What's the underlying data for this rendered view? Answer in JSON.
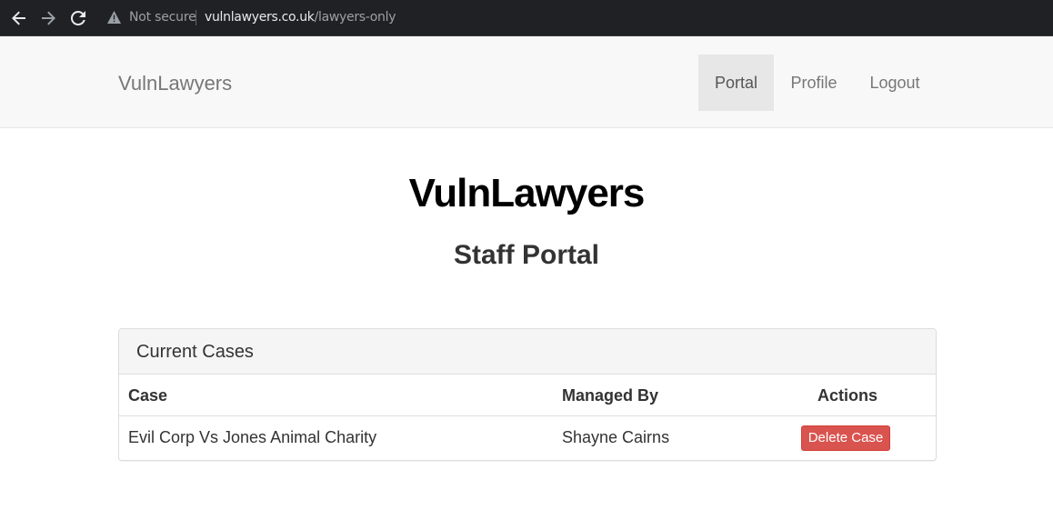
{
  "browser": {
    "security_label": "Not secure",
    "url_host": "vulnlawyers.co.uk",
    "url_path": "/lawyers-only",
    "icons": {
      "back": "arrow-left-icon",
      "forward": "arrow-right-icon",
      "reload": "reload-icon",
      "warning": "warning-triangle-icon"
    }
  },
  "navbar": {
    "brand": "VulnLawyers",
    "items": [
      {
        "label": "Portal",
        "active": true
      },
      {
        "label": "Profile",
        "active": false
      },
      {
        "label": "Logout",
        "active": false
      }
    ]
  },
  "page": {
    "title": "VulnLawyers",
    "subtitle": "Staff Portal"
  },
  "cases_panel": {
    "heading": "Current Cases",
    "columns": [
      "Case",
      "Managed By",
      "Actions"
    ],
    "rows": [
      {
        "case": "Evil Corp Vs Jones Animal Charity",
        "managed_by": "Shayne Cairns",
        "action_label": "Delete Case"
      }
    ]
  },
  "colors": {
    "browser_bg": "#202124",
    "navbar_bg": "#f8f8f8",
    "active_nav_bg": "#e7e7e7",
    "danger": "#d9534f"
  }
}
